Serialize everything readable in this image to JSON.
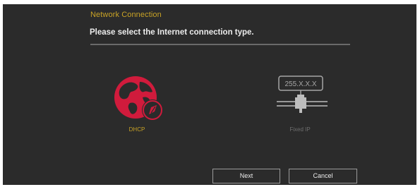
{
  "header": {
    "title": "Network Connection",
    "subtitle": "Please select the Internet connection type."
  },
  "options": [
    {
      "label": "DHCP",
      "icon": "globe-icon",
      "selected": true
    },
    {
      "label": "Fixed IP",
      "icon": "ip-connector-icon",
      "selected": false,
      "ip_text": "255.X.X.X"
    }
  ],
  "buttons": {
    "next": "Next",
    "cancel": "Cancel"
  },
  "colors": {
    "background": "#2b2b2b",
    "accent_gold": "#c9a326",
    "accent_red": "#d01b3c",
    "inactive": "#6f6f6f"
  }
}
